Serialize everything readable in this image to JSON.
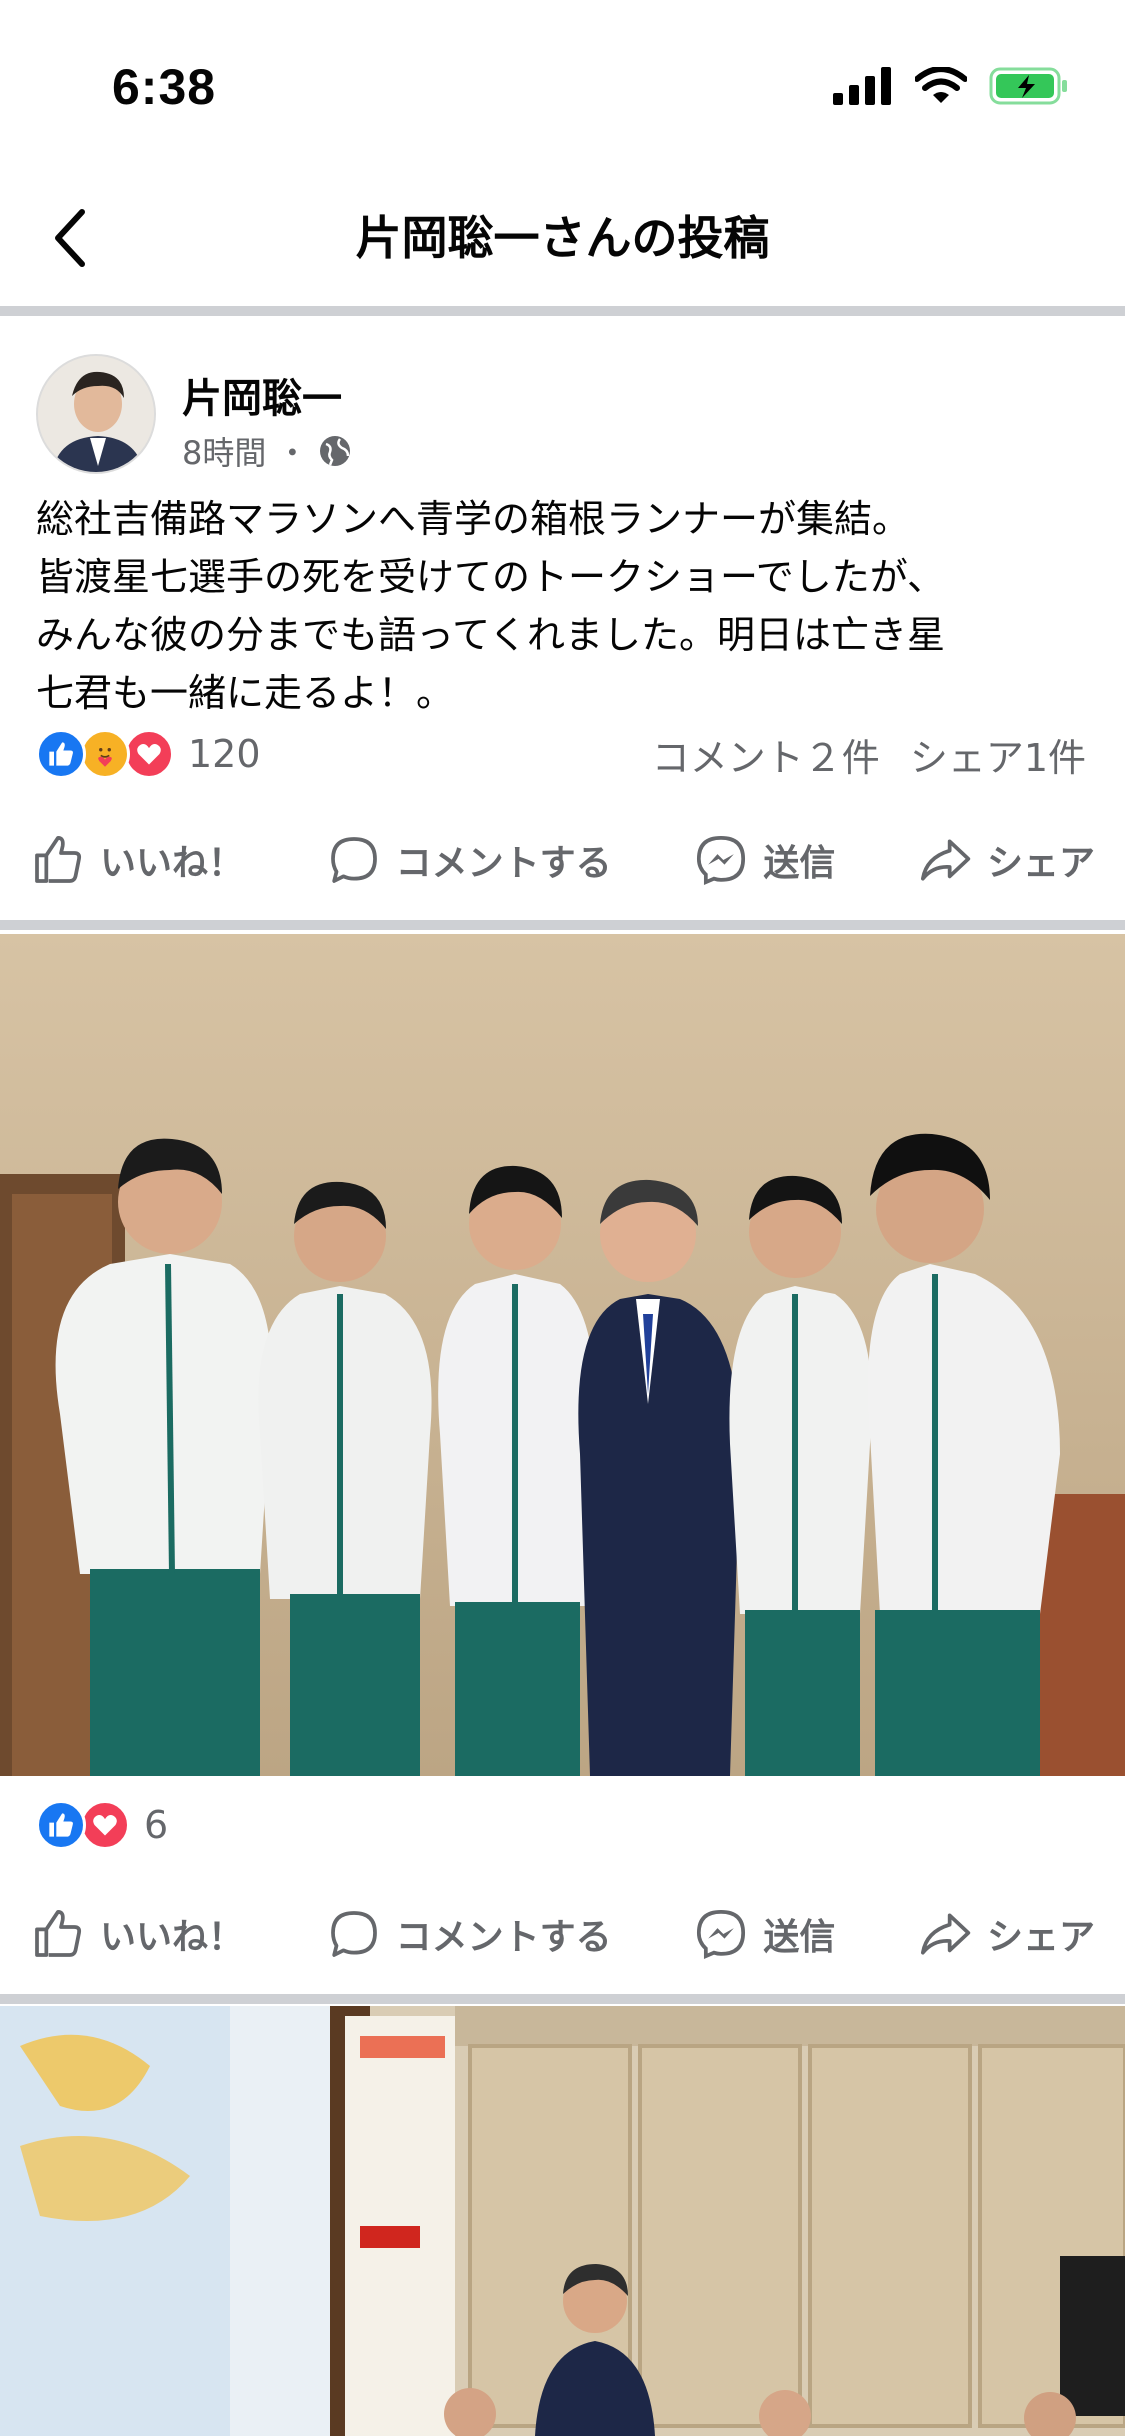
{
  "status": {
    "time": "6:38"
  },
  "nav": {
    "title": "片岡聡一さんの投稿"
  },
  "post": {
    "author": "片岡聡一",
    "time": "8時間",
    "dot": "・",
    "text_lines": [
      "総社吉備路マラソンへ青学の箱根ランナーが集結。",
      "皆渡星七選手の死を受けてのトークショーでしたが、",
      "みんな彼の分までも語ってくれました。明日は亡き星",
      "七君も一緒に走るよ！。"
    ],
    "reaction_count": "120",
    "comments": "コメント２件",
    "shares": "シェア1件"
  },
  "actions": {
    "like": "いいね！",
    "comment": "コメントする",
    "send": "送信",
    "share": "シェア"
  },
  "photo1": {
    "reaction_count": "6"
  },
  "colors": {
    "facebook_blue": "#1877f2",
    "love_red": "#f33e58",
    "care_yellow": "#f7b125",
    "divider": "#ced0d4",
    "muted": "#65676b"
  },
  "icons": [
    "back-chevron-icon",
    "signal-icon",
    "wifi-icon",
    "battery-icon",
    "globe-icon",
    "like-reaction-icon",
    "care-reaction-icon",
    "love-reaction-icon",
    "thumbs-up-icon",
    "comment-bubble-icon",
    "messenger-icon",
    "share-arrow-icon"
  ]
}
